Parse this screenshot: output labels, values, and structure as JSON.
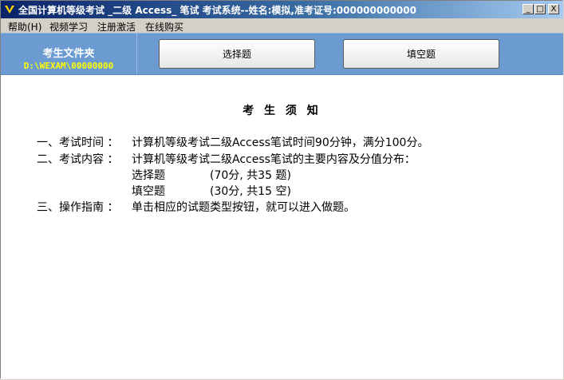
{
  "window": {
    "title": "全国计算机等级考试 _二级 Access_ 笔试 考试系统--姓名:模拟,准考证号:000000000000",
    "controls": {
      "minimize": "_",
      "maximize": "□",
      "close": "X"
    }
  },
  "menu": {
    "items": [
      "帮助(H)",
      "视频学习",
      "注册激活",
      "在线购买"
    ]
  },
  "toolbar": {
    "folder_title": "考生文件夹",
    "folder_path": "D:\\WEXAM\\00000000",
    "buttons": [
      "选择题",
      "填空题"
    ]
  },
  "notice": {
    "heading": "考 生 须 知",
    "items": [
      {
        "label": "一、考试时间 ：",
        "text": "计算机等级考试二级Access笔试时间90分钟，满分100分。"
      },
      {
        "label": "二、考试内容 ：",
        "text": "计算机等级考试二级Access笔试的主要内容及分值分布："
      },
      {
        "label": "三、操作指南 ：",
        "text": "单击相应的试题类型按钮，就可以进入做题。"
      }
    ],
    "score_rows": [
      {
        "type": "选择题",
        "detail": "(70分, 共35 题)"
      },
      {
        "type": "填空题",
        "detail": "(30分, 共15 空)"
      }
    ]
  },
  "colors": {
    "title_bar_start": "#0a246a",
    "title_bar_end": "#a6caf0",
    "toolbar_bg": "#6b9bd1",
    "folder_path_color": "#ffff00"
  }
}
